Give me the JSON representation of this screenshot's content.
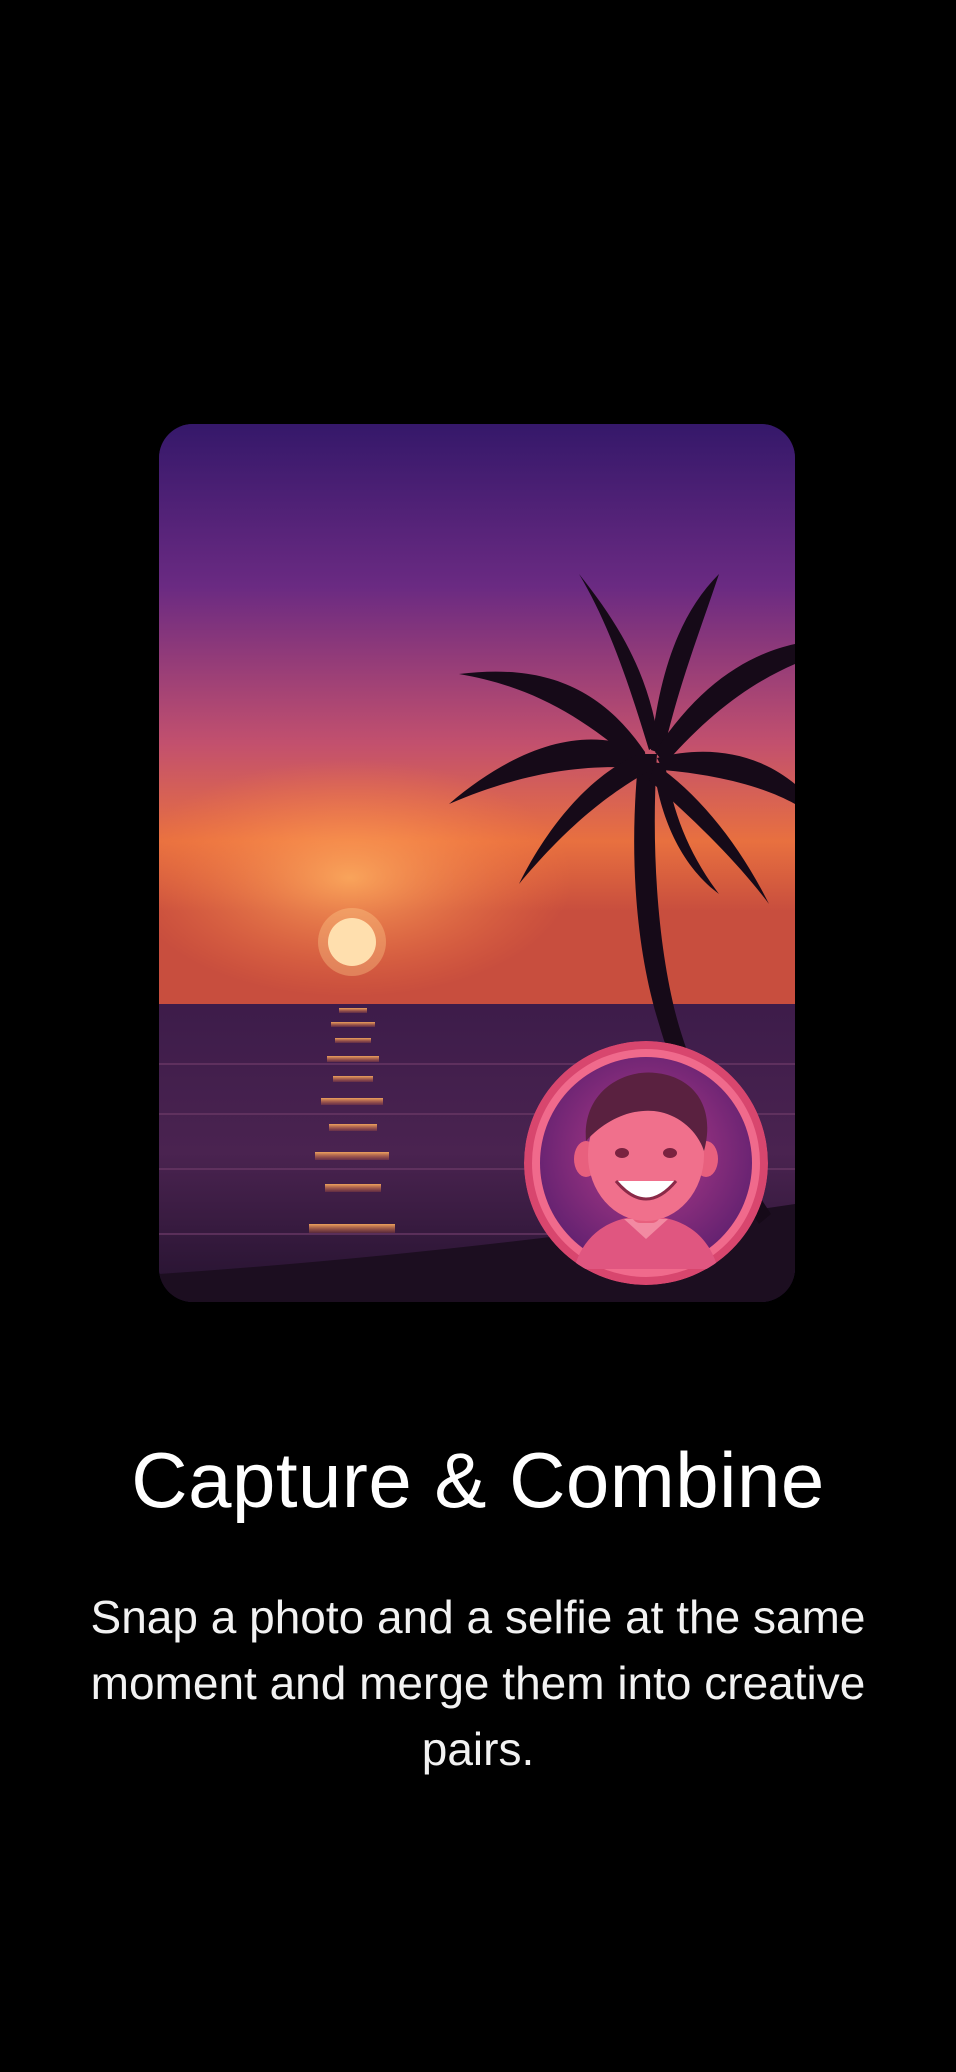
{
  "onboarding": {
    "title": "Capture & Combine",
    "description": "Snap a photo and a selfie at the same moment and merge them into creative pairs.",
    "hero_image": "sunset-beach-palm-photo",
    "selfie_image": "smiling-avatar-selfie"
  },
  "colors": {
    "background": "#000000",
    "text": "#ffffff",
    "sky_top": "#3a1a6e",
    "sky_mid": "#b8467a",
    "sky_horizon": "#ef7a3f",
    "sun": "#ffe9c2",
    "selfie_ring": "#d8466e"
  }
}
